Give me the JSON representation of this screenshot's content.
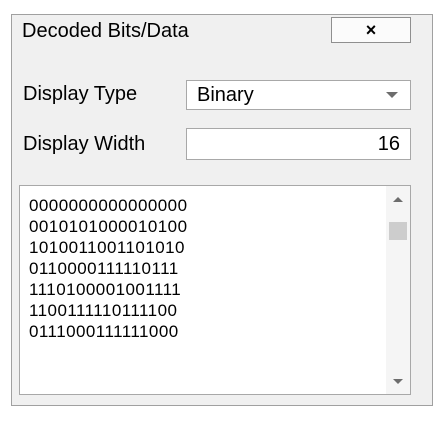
{
  "panel": {
    "title": "Decoded Bits/Data",
    "close_label": "×"
  },
  "display_type": {
    "label": "Display Type",
    "value": "Binary"
  },
  "display_width": {
    "label": "Display Width",
    "value": "16"
  },
  "output": {
    "lines": [
      "0000000000000000",
      "0010101000010100",
      "1010011001101010",
      "0110000111110111",
      "1110100001001111",
      "1100111110111100",
      "0111000111111000"
    ]
  },
  "icons": {
    "close": "close-icon",
    "dropdown": "chevron-down-icon",
    "scroll_up": "scroll-up-arrow-icon",
    "scroll_down": "scroll-down-arrow-icon"
  }
}
